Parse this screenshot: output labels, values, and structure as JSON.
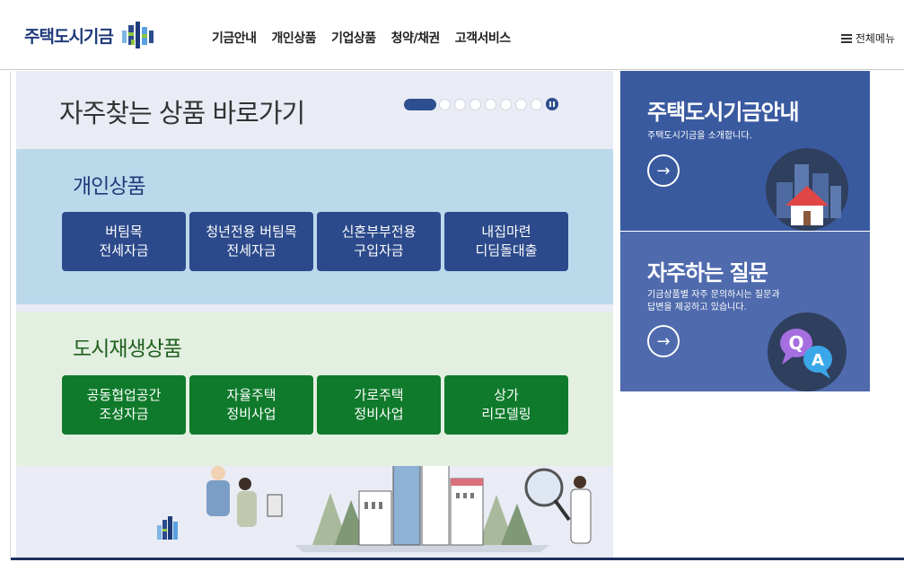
{
  "header": {
    "logo_text": "주택도시기금",
    "nav": [
      "기금안내",
      "개인상품",
      "기업상품",
      "청약/채권",
      "고객서비스"
    ],
    "all_menu": "전체메뉴"
  },
  "main": {
    "title": "자주찾는 상품 바로가기",
    "personal": {
      "title": "개인상품",
      "buttons": [
        "버팀목\n전세자금",
        "청년전용 버팀목\n전세자금",
        "신혼부부전용\n구입자금",
        "내집마련\n디딤돌대출"
      ]
    },
    "urban": {
      "title": "도시재생상품",
      "buttons": [
        "공동협업공간\n조성자금",
        "자율주택\n정비사업",
        "가로주택\n정비사업",
        "상가\n리모델링"
      ]
    },
    "illustration_logo": "주택도시기금"
  },
  "cards": [
    {
      "title": "주택도시기금안내",
      "desc": "주택도시기금을 소개합니다."
    },
    {
      "title": "자주하는 질문",
      "desc": "기금상품별 자주 문의하시는 질문과\n답변을 제공하고 있습니다."
    }
  ],
  "colors": {
    "brand_navy": "#2c4a8b",
    "brand_green": "#0f7a2b",
    "card_blue": "#3a5aa0"
  }
}
